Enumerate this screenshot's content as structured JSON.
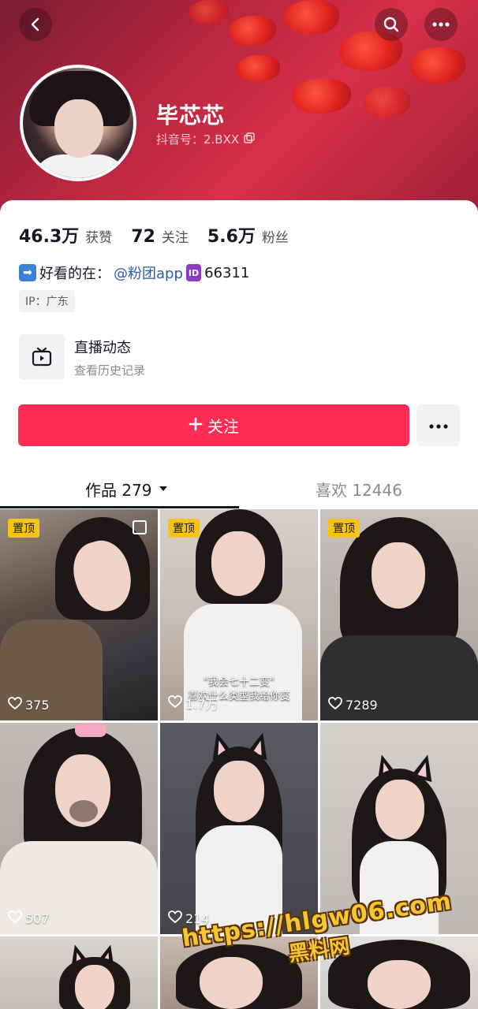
{
  "header": {
    "name": "毕芯芯",
    "douyin_id": "抖音号：2.BXX",
    "icons": {
      "back": "back-arrow-icon",
      "search": "search-icon",
      "more": "more-dots-icon",
      "copy": "copy-icon"
    }
  },
  "stats": [
    {
      "num": "46.3万",
      "label": "获赞"
    },
    {
      "num": "72",
      "label": "关注"
    },
    {
      "num": "5.6万",
      "label": "粉丝"
    }
  ],
  "bio": {
    "prefix": "好看的在：",
    "link": "@粉团app",
    "id_badge": "ID",
    "id_number": "66311"
  },
  "ip": "IP：广东",
  "live": {
    "title": "直播动态",
    "subtitle": "查看历史记录"
  },
  "follow": {
    "label": "关注",
    "accent": "#fe2c55"
  },
  "tabs": {
    "works": "作品 279",
    "likes": "喜欢 12446"
  },
  "grid": {
    "pin_label": "置顶",
    "items": [
      {
        "likes": "375",
        "pinned": true
      },
      {
        "likes": "1.7万",
        "pinned": true,
        "caption1": "\"我会七十二变\"",
        "caption2": "喜欢什么类型我给你变"
      },
      {
        "likes": "7289",
        "pinned": true
      },
      {
        "likes": "507",
        "pinned": false
      },
      {
        "likes": "214",
        "pinned": false
      },
      {
        "likes": "",
        "pinned": false
      }
    ]
  },
  "watermark": {
    "url": "https://hlgw06.com",
    "text": "黑料网"
  }
}
